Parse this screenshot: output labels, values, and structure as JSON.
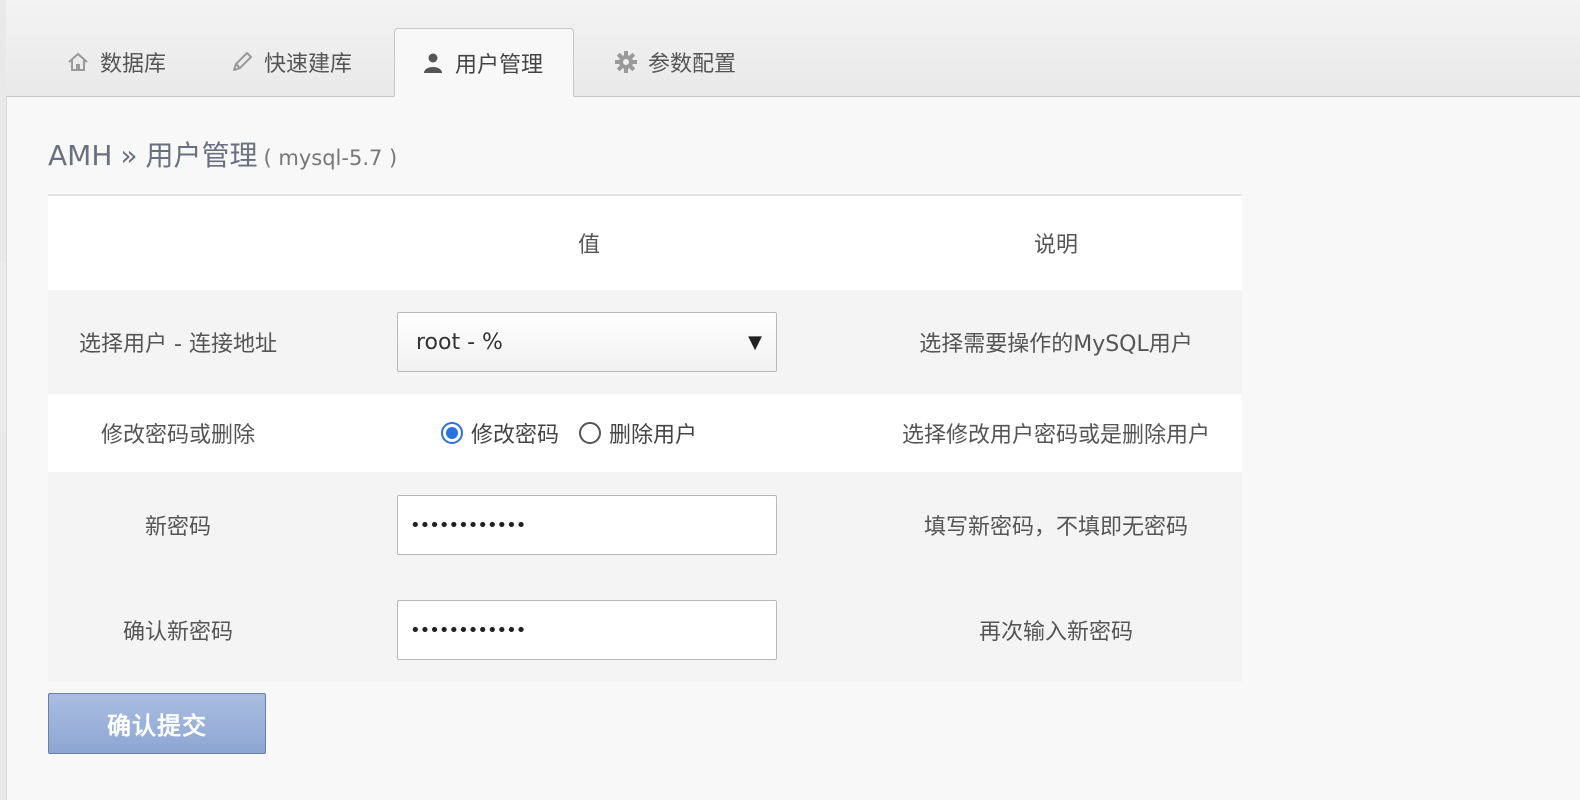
{
  "tabs": [
    {
      "label": "数据库",
      "icon": "home-icon",
      "active": false
    },
    {
      "label": "快速建库",
      "icon": "pencil-icon",
      "active": false
    },
    {
      "label": "用户管理",
      "icon": "user-icon",
      "active": true
    },
    {
      "label": "参数配置",
      "icon": "gear-icon",
      "active": false
    }
  ],
  "breadcrumb": {
    "root": "AMH",
    "separator": "»",
    "current": "用户管理",
    "version": "( mysql-5.7 )"
  },
  "table": {
    "headers": {
      "value": "值",
      "description": "说明"
    },
    "user_row": {
      "label": "选择用户 - 连接地址",
      "selected_user": "root - %",
      "description": "选择需要操作的MySQL用户"
    },
    "action_row": {
      "label": "修改密码或删除",
      "options": [
        "修改密码",
        "删除用户"
      ],
      "selected_option": "修改密码",
      "description": "选择修改用户密码或是删除用户"
    },
    "new_password_row": {
      "label": "新密码",
      "value": "••••••••••••",
      "description": "填写新密码，不填即无密码"
    },
    "confirm_password_row": {
      "label": "确认新密码",
      "value": "••••••••••••",
      "description": "再次输入新密码"
    }
  },
  "submit_label": "确认提交",
  "colors": {
    "radio_accent": "#2a72e0",
    "submit_bg": "#9cb2da",
    "breadcrumb": "#6a7080"
  }
}
